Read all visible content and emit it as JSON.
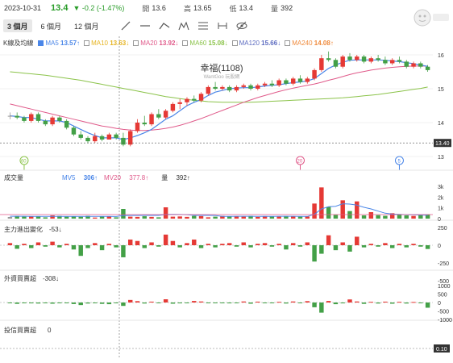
{
  "header": {
    "date": "2023-10-31",
    "price": "13.4",
    "change": "▼ -0.2 (-1.47%)",
    "open_label": "開",
    "open": "13.6",
    "high_label": "高",
    "high": "13.65",
    "low_label": "低",
    "low": "13.4",
    "volume_label": "量",
    "volume": "392"
  },
  "tabs": [
    "3 個月",
    "6 個月",
    "12 個月"
  ],
  "active_tab": 0,
  "tools": [
    "line-draw-icon",
    "horizontal-line-icon",
    "trend-line-icon",
    "pattern-icon",
    "fibonacci-icon",
    "measure-icon",
    "hide-icon"
  ],
  "legend": {
    "title": "K線及均線",
    "items": [
      {
        "label": "MA5",
        "value": "13.57↑",
        "color": "#4a86e8",
        "checked": true
      },
      {
        "label": "MA10",
        "value": "13.63↓",
        "color": "#e6b422",
        "checked": false
      },
      {
        "label": "MA20",
        "value": "13.92↓",
        "color": "#e05a8a",
        "checked": false
      },
      {
        "label": "MA60",
        "value": "15.08↓",
        "color": "#8bc34a",
        "checked": false
      },
      {
        "label": "MA120",
        "value": "15.66↓",
        "color": "#5c6bc0",
        "checked": false
      },
      {
        "label": "MA240",
        "value": "14.08↑",
        "color": "#ef8a3c",
        "checked": false
      }
    ]
  },
  "stock": {
    "name": "幸福(1108)",
    "source": "WantGoo 玩股網"
  },
  "price_axis": {
    "ticks": [
      "16",
      "15",
      "14",
      "13"
    ],
    "current": "13.40"
  },
  "price_markers": [
    "60",
    "20",
    "5"
  ],
  "volume_panel": {
    "title": "成交量",
    "mv5_label": "MV5",
    "mv5_value": "306↑",
    "mv20_label": "MV20",
    "mv20_value": "377.8↑",
    "vol_label": "量",
    "vol_value": "392↑",
    "ticks": [
      "3k",
      "2k",
      "1k",
      "0"
    ]
  },
  "main_force_panel": {
    "title": "主力進出變化",
    "value": "-53↓",
    "ticks": [
      "250",
      "0",
      "-250",
      "-500"
    ]
  },
  "foreign_panel": {
    "title": "外資買賣超",
    "value": "-308↓",
    "ticks": [
      "1000",
      "500",
      "0",
      "-500",
      "-1000"
    ]
  },
  "trust_panel": {
    "title": "投信買賣超",
    "value": "0",
    "current": "0.10"
  },
  "colors": {
    "up": "#e53935",
    "down": "#43a047",
    "flat": "#999999",
    "ma5": "#4a86e8",
    "ma20": "#e05a8a",
    "ma60": "#8bc34a"
  },
  "chart_data": {
    "type": "candlestick",
    "ohlc": [
      [
        14.2,
        14.3,
        14.1,
        14.2
      ],
      [
        14.2,
        14.3,
        14.1,
        14.15
      ],
      [
        14.15,
        14.2,
        14.0,
        14.05
      ],
      [
        14.05,
        14.3,
        14.0,
        14.25
      ],
      [
        14.25,
        14.3,
        14.0,
        14.05
      ],
      [
        14.05,
        14.1,
        13.9,
        13.95
      ],
      [
        13.95,
        14.2,
        13.9,
        14.15
      ],
      [
        14.15,
        14.2,
        14.0,
        14.05
      ],
      [
        14.05,
        14.1,
        13.8,
        13.85
      ],
      [
        13.85,
        13.9,
        13.6,
        13.65
      ],
      [
        13.65,
        13.75,
        13.5,
        13.55
      ],
      [
        13.55,
        13.6,
        13.4,
        13.45
      ],
      [
        13.45,
        13.7,
        13.4,
        13.6
      ],
      [
        13.6,
        13.65,
        13.45,
        13.5
      ],
      [
        13.5,
        13.7,
        13.5,
        13.65
      ],
      [
        13.65,
        13.7,
        13.5,
        13.55
      ],
      [
        13.55,
        13.7,
        13.3,
        13.35
      ],
      [
        13.35,
        13.8,
        13.3,
        13.75
      ],
      [
        13.75,
        14.1,
        13.7,
        14.0
      ],
      [
        14.0,
        14.2,
        13.9,
        13.95
      ],
      [
        13.95,
        14.3,
        13.9,
        14.25
      ],
      [
        14.25,
        14.4,
        14.1,
        14.15
      ],
      [
        14.15,
        14.4,
        14.1,
        14.35
      ],
      [
        14.35,
        14.6,
        14.3,
        14.55
      ],
      [
        14.55,
        14.7,
        14.4,
        14.6
      ],
      [
        14.6,
        14.75,
        14.5,
        14.7
      ],
      [
        14.7,
        14.8,
        14.6,
        14.65
      ],
      [
        14.65,
        14.9,
        14.6,
        14.85
      ],
      [
        14.85,
        15.1,
        14.8,
        15.05
      ],
      [
        15.05,
        15.2,
        14.95,
        15.0
      ],
      [
        15.0,
        15.1,
        14.95,
        15.05
      ],
      [
        15.05,
        15.1,
        14.9,
        14.95
      ],
      [
        14.95,
        15.1,
        14.9,
        15.05
      ],
      [
        15.05,
        15.15,
        15.0,
        15.1
      ],
      [
        15.1,
        15.15,
        14.95,
        15.0
      ],
      [
        15.0,
        15.15,
        14.95,
        15.1
      ],
      [
        15.1,
        15.2,
        15.05,
        15.15
      ],
      [
        15.15,
        15.25,
        15.05,
        15.1
      ],
      [
        15.1,
        15.3,
        15.05,
        15.25
      ],
      [
        15.25,
        15.3,
        15.1,
        15.15
      ],
      [
        15.15,
        15.35,
        15.1,
        15.3
      ],
      [
        15.3,
        15.4,
        15.15,
        15.2
      ],
      [
        15.2,
        15.35,
        15.15,
        15.3
      ],
      [
        15.3,
        15.6,
        15.25,
        15.55
      ],
      [
        15.55,
        16.0,
        15.5,
        15.9
      ],
      [
        15.9,
        16.1,
        15.8,
        15.85
      ],
      [
        15.85,
        15.9,
        15.6,
        15.65
      ],
      [
        15.65,
        16.0,
        15.6,
        15.95
      ],
      [
        15.95,
        16.05,
        15.8,
        15.85
      ],
      [
        15.85,
        16.0,
        15.8,
        15.95
      ],
      [
        15.95,
        16.0,
        15.75,
        15.8
      ],
      [
        15.8,
        15.95,
        15.75,
        15.9
      ],
      [
        15.9,
        16.0,
        15.8,
        15.85
      ],
      [
        15.85,
        15.95,
        15.7,
        15.75
      ],
      [
        15.75,
        15.9,
        15.7,
        15.85
      ],
      [
        15.85,
        15.95,
        15.75,
        15.8
      ],
      [
        15.8,
        15.85,
        15.6,
        15.65
      ],
      [
        15.65,
        15.8,
        15.6,
        15.75
      ],
      [
        15.75,
        15.8,
        15.6,
        15.65
      ],
      [
        15.65,
        15.7,
        15.5,
        15.55
      ]
    ],
    "ma5": [
      14.2,
      14.18,
      14.15,
      14.15,
      14.1,
      14.05,
      14.05,
      14.05,
      14.0,
      13.9,
      13.8,
      13.7,
      13.62,
      13.55,
      13.55,
      13.55,
      13.5,
      13.55,
      13.62,
      13.7,
      13.8,
      13.95,
      14.1,
      14.2,
      14.35,
      14.5,
      14.6,
      14.68,
      14.8,
      14.9,
      14.95,
      15.0,
      15.02,
      15.03,
      15.03,
      15.05,
      15.08,
      15.1,
      15.12,
      15.15,
      15.18,
      15.2,
      15.23,
      15.3,
      15.45,
      15.6,
      15.7,
      15.78,
      15.84,
      15.85,
      15.85,
      15.85,
      15.85,
      15.84,
      15.82,
      15.8,
      15.77,
      15.74,
      15.7,
      15.66
    ],
    "ma20": [
      14.55,
      14.5,
      14.45,
      14.4,
      14.35,
      14.3,
      14.25,
      14.2,
      14.15,
      14.1,
      14.05,
      14.0,
      13.95,
      13.9,
      13.87,
      13.83,
      13.8,
      13.78,
      13.77,
      13.77,
      13.78,
      13.8,
      13.83,
      13.87,
      13.92,
      13.98,
      14.05,
      14.12,
      14.2,
      14.28,
      14.36,
      14.44,
      14.52,
      14.6,
      14.67,
      14.74,
      14.8,
      14.86,
      14.92,
      14.97,
      15.02,
      15.06,
      15.1,
      15.14,
      15.19,
      15.25,
      15.3,
      15.36,
      15.42,
      15.47,
      15.51,
      15.55,
      15.58,
      15.61,
      15.63,
      15.65,
      15.66,
      15.67,
      15.67,
      15.67
    ],
    "ma60": [
      15.5,
      15.48,
      15.46,
      15.44,
      15.42,
      15.4,
      15.37,
      15.34,
      15.31,
      15.28,
      15.25,
      15.21,
      15.17,
      15.13,
      15.09,
      15.05,
      15.01,
      14.97,
      14.93,
      14.89,
      14.85,
      14.81,
      14.77,
      14.74,
      14.71,
      14.68,
      14.66,
      14.64,
      14.62,
      14.61,
      14.6,
      14.6,
      14.6,
      14.6,
      14.6,
      14.61,
      14.62,
      14.63,
      14.64,
      14.65,
      14.66,
      14.67,
      14.68,
      14.69,
      14.7,
      14.71,
      14.72,
      14.73,
      14.75,
      14.77,
      14.79,
      14.81,
      14.83,
      14.86,
      14.89,
      14.92,
      14.95,
      14.98,
      15.01,
      15.05
    ],
    "volume": [
      150,
      250,
      180,
      200,
      230,
      120,
      300,
      250,
      180,
      210,
      170,
      260,
      100,
      190,
      220,
      120,
      900,
      180,
      160,
      220,
      160,
      120,
      1050,
      180,
      200,
      160,
      250,
      230,
      120,
      180,
      250,
      200,
      220,
      180,
      250,
      160,
      220,
      210,
      180,
      240,
      200,
      180,
      200,
      1400,
      2900,
      1100,
      350,
      1700,
      700,
      1600,
      300,
      600,
      320,
      260,
      500,
      350,
      300,
      250,
      350,
      392
    ],
    "vol_ma": [
      220,
      220,
      215,
      210,
      210,
      205,
      210,
      212,
      208,
      205,
      205,
      210,
      205,
      200,
      200,
      195,
      280,
      290,
      295,
      300,
      300,
      298,
      380,
      390,
      380,
      370,
      300,
      300,
      300,
      290,
      210,
      210,
      220,
      220,
      215,
      210,
      215,
      210,
      215,
      220,
      215,
      210,
      205,
      400,
      900,
      1100,
      1150,
      1380,
      1350,
      1250,
      1050,
      900,
      700,
      500,
      420,
      400,
      370,
      350,
      340,
      306
    ],
    "main_force": [
      30,
      -50,
      20,
      -40,
      40,
      -20,
      50,
      -30,
      20,
      -60,
      -150,
      -40,
      30,
      -70,
      20,
      -30,
      -170,
      80,
      60,
      -40,
      40,
      -20,
      150,
      60,
      -30,
      30,
      80,
      -40,
      20,
      -30,
      20,
      30,
      -20,
      40,
      -30,
      20,
      30,
      -20,
      20,
      -60,
      30,
      -20,
      40,
      -230,
      -120,
      140,
      -70,
      40,
      -90,
      120,
      -30,
      20,
      -20,
      30,
      -40,
      20,
      -30,
      20,
      -20,
      -53
    ],
    "foreign": [
      -40,
      -80,
      -30,
      -50,
      -60,
      -20,
      -70,
      -40,
      -30,
      -90,
      -150,
      -60,
      -40,
      -80,
      -100,
      -30,
      -200,
      150,
      80,
      -60,
      50,
      -40,
      190,
      -70,
      -50,
      -40,
      90,
      60,
      -40,
      -20,
      -30,
      -50,
      -40,
      60,
      -70,
      50,
      -40,
      -30,
      40,
      -60,
      60,
      -40,
      80,
      -280,
      -600,
      90,
      -100,
      -50,
      180,
      60,
      -80,
      40,
      -60,
      50,
      -70,
      40,
      -60,
      30,
      -40,
      -308
    ]
  }
}
